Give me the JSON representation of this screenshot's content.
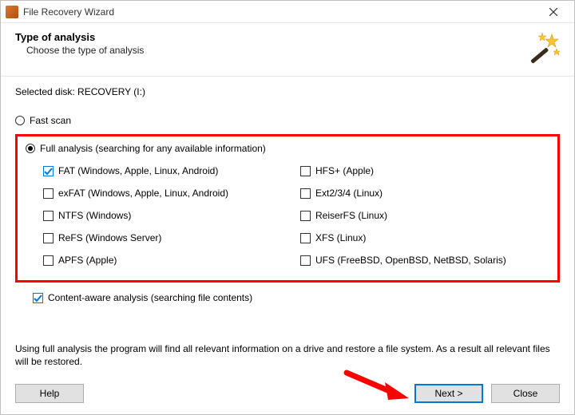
{
  "window": {
    "title": "File Recovery Wizard"
  },
  "header": {
    "heading": "Type of analysis",
    "sub": "Choose the type of analysis"
  },
  "selected_disk_label": "Selected disk: RECOVERY (I:)",
  "scan": {
    "fast_label": "Fast scan",
    "full_label": "Full analysis (searching for any available information)",
    "content_aware_label": "Content-aware analysis (searching file contents)"
  },
  "filesystems": {
    "left": [
      {
        "label": "FAT (Windows, Apple, Linux, Android)",
        "checked": true
      },
      {
        "label": "exFAT (Windows, Apple, Linux, Android)",
        "checked": false
      },
      {
        "label": "NTFS (Windows)",
        "checked": false
      },
      {
        "label": "ReFS (Windows Server)",
        "checked": false
      },
      {
        "label": "APFS (Apple)",
        "checked": false
      }
    ],
    "right": [
      {
        "label": "HFS+ (Apple)",
        "checked": false
      },
      {
        "label": "Ext2/3/4 (Linux)",
        "checked": false
      },
      {
        "label": "ReiserFS (Linux)",
        "checked": false
      },
      {
        "label": "XFS (Linux)",
        "checked": false
      },
      {
        "label": "UFS (FreeBSD, OpenBSD, NetBSD, Solaris)",
        "checked": false
      }
    ]
  },
  "description": "Using full analysis the program will find all relevant information on a drive and restore a file system. As a result all relevant files will be restored.",
  "buttons": {
    "help": "Help",
    "next": "Next >",
    "close": "Close"
  }
}
